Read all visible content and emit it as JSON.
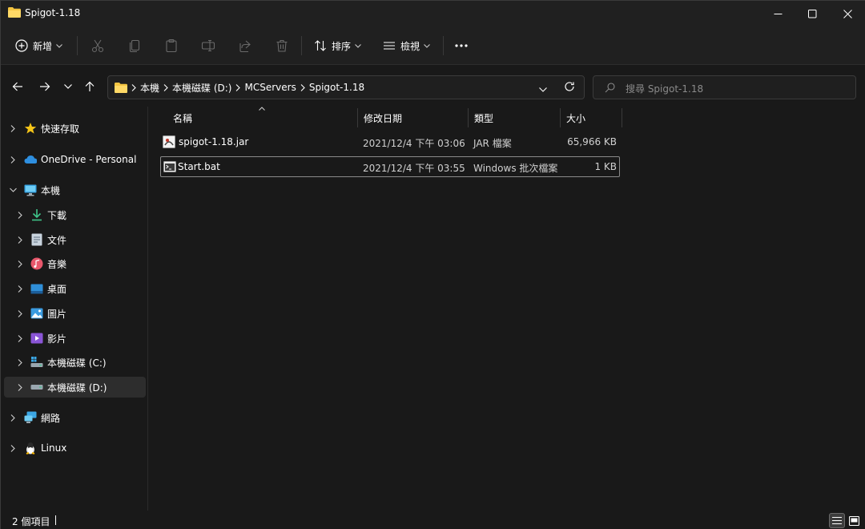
{
  "window": {
    "title": "Spigot-1.18",
    "controls": [
      "minimize",
      "maximize",
      "close"
    ]
  },
  "commandbar": {
    "new_label": "新增",
    "sort_label": "排序",
    "view_label": "檢視",
    "actions": [
      "cut",
      "copy",
      "paste",
      "rename",
      "share",
      "delete",
      "more"
    ]
  },
  "address": {
    "breadcrumbs": [
      "本機",
      "本機磁碟 (D:)",
      "MCServers",
      "Spigot-1.18"
    ]
  },
  "search": {
    "placeholder": "搜尋 Spigot-1.18"
  },
  "sidebar": {
    "items": [
      {
        "label": "快速存取",
        "icon": "star-icon",
        "expanded": false
      },
      {
        "label": "OneDrive - Personal",
        "icon": "cloud-icon",
        "expanded": false
      },
      {
        "label": "本機",
        "icon": "computer-icon",
        "expanded": true
      },
      {
        "label": "下載",
        "icon": "download-icon",
        "expanded": false
      },
      {
        "label": "文件",
        "icon": "document-icon",
        "expanded": false
      },
      {
        "label": "音樂",
        "icon": "music-icon",
        "expanded": false
      },
      {
        "label": "桌面",
        "icon": "desktop-icon",
        "expanded": false
      },
      {
        "label": "圖片",
        "icon": "pictures-icon",
        "expanded": false
      },
      {
        "label": "影片",
        "icon": "videos-icon",
        "expanded": false
      },
      {
        "label": "本機磁碟 (C:)",
        "icon": "windows-drive-icon",
        "expanded": false
      },
      {
        "label": "本機磁碟 (D:)",
        "icon": "drive-icon",
        "expanded": false,
        "selected": true
      },
      {
        "label": "網路",
        "icon": "network-icon",
        "expanded": false
      },
      {
        "label": "Linux",
        "icon": "linux-icon",
        "expanded": false
      }
    ]
  },
  "filelist": {
    "columns": [
      "名稱",
      "修改日期",
      "類型",
      "大小"
    ],
    "sorted_by": "名稱",
    "rows": [
      {
        "name": "spigot-1.18.jar",
        "modified": "2021/12/4 下午 03:06",
        "type": "JAR 檔案",
        "size": "65,966 KB",
        "icon": "jar-file-icon"
      },
      {
        "name": "Start.bat",
        "modified": "2021/12/4 下午 03:55",
        "type": "Windows 批次檔案",
        "size": "1 KB",
        "icon": "batch-file-icon",
        "selected": true
      }
    ]
  },
  "statusbar": {
    "item_count": "2 個項目",
    "views": [
      "details",
      "large-icons"
    ],
    "active_view": "details"
  }
}
